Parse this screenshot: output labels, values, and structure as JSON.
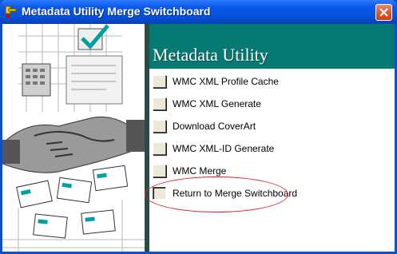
{
  "window": {
    "title": "Metadata Utility Merge Switchboard",
    "icons": {
      "app": "key-app-icon",
      "close": "close-x-icon"
    }
  },
  "form": {
    "heading": "Metadata Utility",
    "items": [
      {
        "label": "WMC XML Profile Cache",
        "state": "normal"
      },
      {
        "label": "WMC XML Generate",
        "state": "normal"
      },
      {
        "label": "Download CoverArt",
        "state": "normal"
      },
      {
        "label": "WMC XML-ID Generate",
        "state": "normal"
      },
      {
        "label": "WMC Merge",
        "state": "normal"
      },
      {
        "label": "Return to Merge Switchboard",
        "state": "pressed",
        "highlighted": true
      }
    ]
  },
  "colors": {
    "titlebar": "#0a58ea",
    "header_band": "#057a73",
    "highlight_ellipse": "#e02020",
    "button_face": "#ece9d8"
  }
}
